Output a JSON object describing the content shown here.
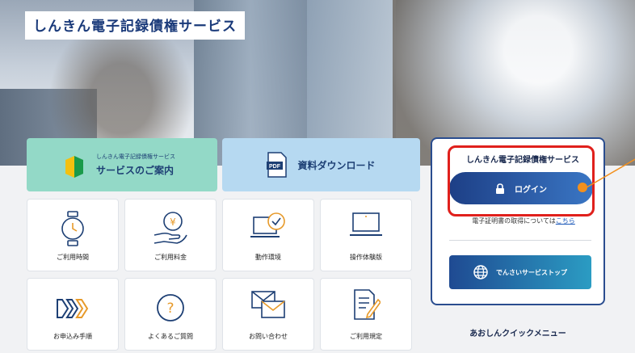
{
  "hero": {
    "title": "しんきん電子記録債権サービス"
  },
  "tiles": {
    "intro": {
      "small": "しんきん電子記録債権サービス",
      "big": "サービスのご案内"
    },
    "download": {
      "label": "資料ダウンロード",
      "icon_text": "PDF"
    }
  },
  "grid": [
    {
      "label": "ご利用時間",
      "icon": "clock-icon"
    },
    {
      "label": "ご利用料金",
      "icon": "yen-hand-icon"
    },
    {
      "label": "動作環境",
      "icon": "laptop-check-icon"
    },
    {
      "label": "操作体験版",
      "icon": "laptop-icon"
    },
    {
      "label": "お申込み手順",
      "icon": "steps-arrows-icon"
    },
    {
      "label": "よくあるご質問",
      "icon": "question-icon"
    },
    {
      "label": "お問い合わせ",
      "icon": "envelope-icon"
    },
    {
      "label": "ご利用規定",
      "icon": "document-pen-icon"
    }
  ],
  "panel": {
    "title": "しんきん電子記録債権サービス",
    "login_label": "ログイン",
    "cert_prefix": "電子証明書の取得については",
    "cert_link": "こちら",
    "densai_label": "でんさいサービストップ"
  },
  "quick_menu": "あおしんクイックメニュー",
  "colors": {
    "accent_navy": "#1d3f86",
    "accent_blue": "#3a76c4",
    "highlight_red": "#e0201c",
    "callout_orange": "#f2901e",
    "tile_green": "#93d9c7",
    "tile_blue": "#b6d9f1"
  }
}
